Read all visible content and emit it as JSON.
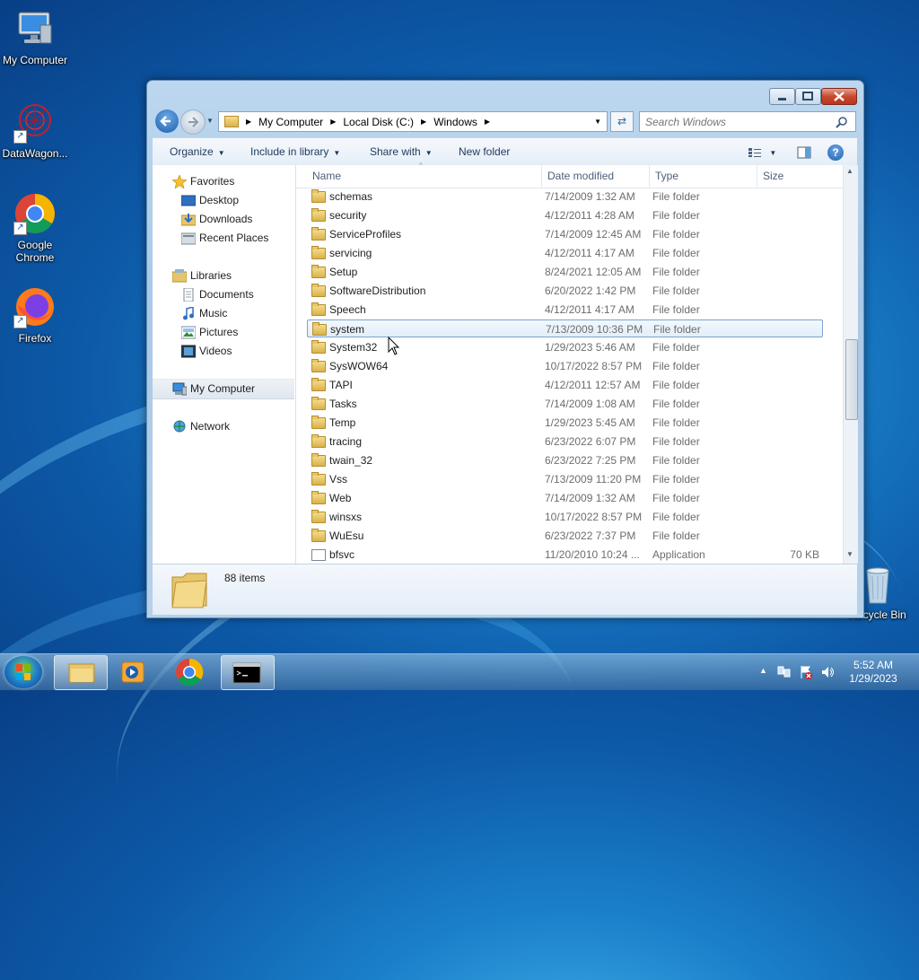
{
  "desktop": {
    "icons": [
      {
        "label": "My Computer"
      },
      {
        "label": "DataWagon..."
      },
      {
        "label": "Google Chrome"
      },
      {
        "label": "Firefox"
      },
      {
        "label": "Recycle Bin"
      }
    ]
  },
  "window": {
    "address": {
      "crumbs": [
        "My Computer",
        "Local Disk (C:)",
        "Windows"
      ]
    },
    "search": {
      "placeholder": "Search Windows"
    },
    "toolbar": {
      "organize": "Organize",
      "include": "Include in library",
      "share": "Share with",
      "new_folder": "New folder"
    },
    "nav": {
      "favorites": "Favorites",
      "desktop": "Desktop",
      "downloads": "Downloads",
      "recent": "Recent Places",
      "libraries": "Libraries",
      "documents": "Documents",
      "music": "Music",
      "pictures": "Pictures",
      "videos": "Videos",
      "computer": "My Computer",
      "network": "Network"
    },
    "columns": {
      "name": "Name",
      "date": "Date modified",
      "type": "Type",
      "size": "Size"
    },
    "files": [
      {
        "name": "schemas",
        "date": "7/14/2009 1:32 AM",
        "type": "File folder",
        "size": ""
      },
      {
        "name": "security",
        "date": "4/12/2011 4:28 AM",
        "type": "File folder",
        "size": ""
      },
      {
        "name": "ServiceProfiles",
        "date": "7/14/2009 12:45 AM",
        "type": "File folder",
        "size": ""
      },
      {
        "name": "servicing",
        "date": "4/12/2011 4:17 AM",
        "type": "File folder",
        "size": ""
      },
      {
        "name": "Setup",
        "date": "8/24/2021 12:05 AM",
        "type": "File folder",
        "size": ""
      },
      {
        "name": "SoftwareDistribution",
        "date": "6/20/2022 1:42 PM",
        "type": "File folder",
        "size": ""
      },
      {
        "name": "Speech",
        "date": "4/12/2011 4:17 AM",
        "type": "File folder",
        "size": ""
      },
      {
        "name": "system",
        "date": "7/13/2009 10:36 PM",
        "type": "File folder",
        "size": ""
      },
      {
        "name": "System32",
        "date": "1/29/2023 5:46 AM",
        "type": "File folder",
        "size": ""
      },
      {
        "name": "SysWOW64",
        "date": "10/17/2022 8:57 PM",
        "type": "File folder",
        "size": ""
      },
      {
        "name": "TAPI",
        "date": "4/12/2011 12:57 AM",
        "type": "File folder",
        "size": ""
      },
      {
        "name": "Tasks",
        "date": "7/14/2009 1:08 AM",
        "type": "File folder",
        "size": ""
      },
      {
        "name": "Temp",
        "date": "1/29/2023 5:45 AM",
        "type": "File folder",
        "size": ""
      },
      {
        "name": "tracing",
        "date": "6/23/2022 6:07 PM",
        "type": "File folder",
        "size": ""
      },
      {
        "name": "twain_32",
        "date": "6/23/2022 7:25 PM",
        "type": "File folder",
        "size": ""
      },
      {
        "name": "Vss",
        "date": "7/13/2009 11:20 PM",
        "type": "File folder",
        "size": ""
      },
      {
        "name": "Web",
        "date": "7/14/2009 1:32 AM",
        "type": "File folder",
        "size": ""
      },
      {
        "name": "winsxs",
        "date": "10/17/2022 8:57 PM",
        "type": "File folder",
        "size": ""
      },
      {
        "name": "WuEsu",
        "date": "6/23/2022 7:37 PM",
        "type": "File folder",
        "size": ""
      },
      {
        "name": "bfsvc",
        "date": "11/20/2010 10:24 ...",
        "type": "Application",
        "size": "70 KB"
      }
    ],
    "details": {
      "count": "88 items"
    }
  },
  "taskbar": {
    "clock_time": "5:52 AM",
    "clock_date": "1/29/2023"
  },
  "colors": {
    "accent": "#1e395b",
    "selection": "#7da2ce"
  }
}
